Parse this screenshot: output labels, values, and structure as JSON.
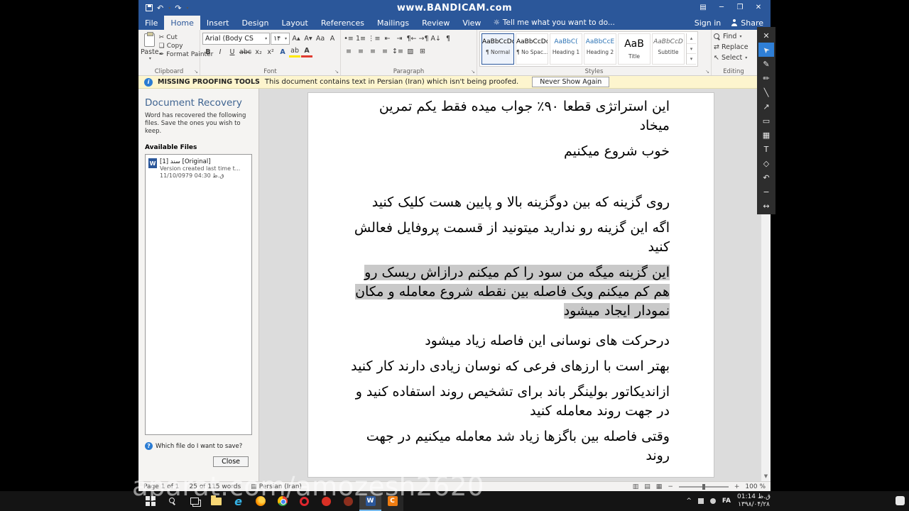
{
  "titlebar": {
    "title": "www.BANDICAM.com"
  },
  "tabs": {
    "items": [
      "File",
      "Home",
      "Insert",
      "Design",
      "Layout",
      "References",
      "Mailings",
      "Review",
      "View"
    ],
    "tellme": "Tell me what you want to do...",
    "signin": "Sign in",
    "share": "Share"
  },
  "ribbon": {
    "clipboard": {
      "label": "Clipboard",
      "paste": "Paste",
      "cut": "Cut",
      "copy": "Copy",
      "format_painter": "Format Painter"
    },
    "font": {
      "label": "Font",
      "name": "Arial (Body CS",
      "size": "۱۴"
    },
    "paragraph": {
      "label": "Paragraph"
    },
    "styles": {
      "label": "Styles",
      "items": [
        {
          "preview": "AaBbCcDc",
          "name": "¶ Normal"
        },
        {
          "preview": "AaBbCcDc",
          "name": "¶ No Spac..."
        },
        {
          "preview": "AaBbC(",
          "name": "Heading 1"
        },
        {
          "preview": "AaBbCcE",
          "name": "Heading 2"
        },
        {
          "preview": "AaB",
          "name": "Title"
        },
        {
          "preview": "AaBbCcD",
          "name": "Subtitle"
        }
      ]
    },
    "editing": {
      "label": "Editing",
      "find": "Find",
      "replace": "Replace",
      "select": "Select"
    }
  },
  "warning": {
    "title": "MISSING PROOFING TOOLS",
    "message": "This document contains text in Persian (Iran) which isn't being proofed.",
    "button": "Never Show Again"
  },
  "recovery": {
    "title": "Document Recovery",
    "desc": "Word has recovered the following files. Save the ones you wish to keep.",
    "files_header": "Available Files",
    "file": {
      "name": "سند [1]  [Original]",
      "detail": "Version created last time t...",
      "date": "11/10/0979 04:30 ق.ظ"
    },
    "question": "Which file do I want to save?",
    "close": "Close"
  },
  "document": {
    "paragraphs": [
      {
        "text": "این استراتژی قطعا ۹۰٪ جواب میده فقط یکم تمرین میخاد"
      },
      {
        "text": "خوب شروع میکنیم"
      },
      {
        "text": ""
      },
      {
        "text": "روی گزینه که بین دوگزینه بالا و پایین هست کلیک کنید"
      },
      {
        "text": "اگه این گزینه رو ندارید میتونید از قسمت پروفایل فعالش کنید"
      },
      {
        "text": "این گزینه میگه من سود را کم میکنم درازاش ریسک رو هم کم میکنم ویک فاصله بین نقطه شروع معامله و مکان نمودار ایجاد میشود"
      },
      {
        "text": "درحرکت های نوسانی این فاصله زیاد میشود"
      },
      {
        "text": "بهتر است با ارزهای فرعی که نوسان زیادی دارند کار کنید"
      },
      {
        "text": "ازاندیکاتور بولینگر باند  برای تشخیص روند استفاده کنید و در جهت روند معامله کنید"
      },
      {
        "text": "وقتی فاصله بین باگزها زیاد شد معامله میکنیم در جهت روند"
      }
    ]
  },
  "status": {
    "page": "Page 1 of 1",
    "words": "25 of 115 words",
    "language": "Persian (Iran)",
    "zoom": "100 %"
  },
  "taskbar": {
    "lang": "FA",
    "time": "01:14 ق.ظ",
    "date": "۱۳۹۸/۰۴/۲۸"
  },
  "watermark": "aparat.com/amozesh2620",
  "icons": {
    "undo": "↶",
    "redo": "↷",
    "dropdown": "▾",
    "ribbon_options": "▤",
    "minimize": "─",
    "restore": "❐",
    "close": "✕",
    "tellme": "☼",
    "cut": "✂",
    "copy": "❏",
    "format_painter": "✒",
    "grow_font": "A▴",
    "shrink_font": "A▾",
    "change_case": "Aa",
    "clear_format": "A",
    "bold": "B",
    "italic": "I",
    "underline": "U",
    "strike": "abc",
    "subscript": "x₂",
    "superscript": "x²",
    "text_effects": "A",
    "text_highlight": "ab",
    "font_color": "A",
    "bullets": "•≡",
    "numbering": "1≡",
    "multilevel": "⋮≡",
    "dec_indent": "⇤",
    "inc_indent": "⇥",
    "rtl": "¶←",
    "ltr": "→¶",
    "sort": "A↓",
    "pilcrow": "¶",
    "align_left": "≡",
    "align_center": "≡",
    "align_right": "≡",
    "justify": "≡",
    "line_spacing": "↕≡",
    "shading": "▨",
    "borders": "⊞",
    "replace": "⇄",
    "select": "↖",
    "gallery_up": "▴",
    "gallery_down": "▾",
    "gallery_more": "▾",
    "launcher": "↘",
    "collapse_ribbon": "▾",
    "scroll_up": "▲",
    "scroll_down": "▼",
    "proofing_book": "▤",
    "view_read": "▥",
    "view_print": "▤",
    "view_web": "▦",
    "zoom_out": "−",
    "zoom_in": "+",
    "tray_caret": "^",
    "bandibar": {
      "close": "✕",
      "cursor": "➤",
      "pen": "✎",
      "marker": "✏",
      "line": "╲",
      "arrow": "↗",
      "rect": "▭",
      "mosaic": "▦",
      "text": "T",
      "eraser": "◇",
      "undo": "↶",
      "minus": "−",
      "resize": "↔"
    },
    "edge": "e",
    "word": "W",
    "bandicam": "C"
  }
}
